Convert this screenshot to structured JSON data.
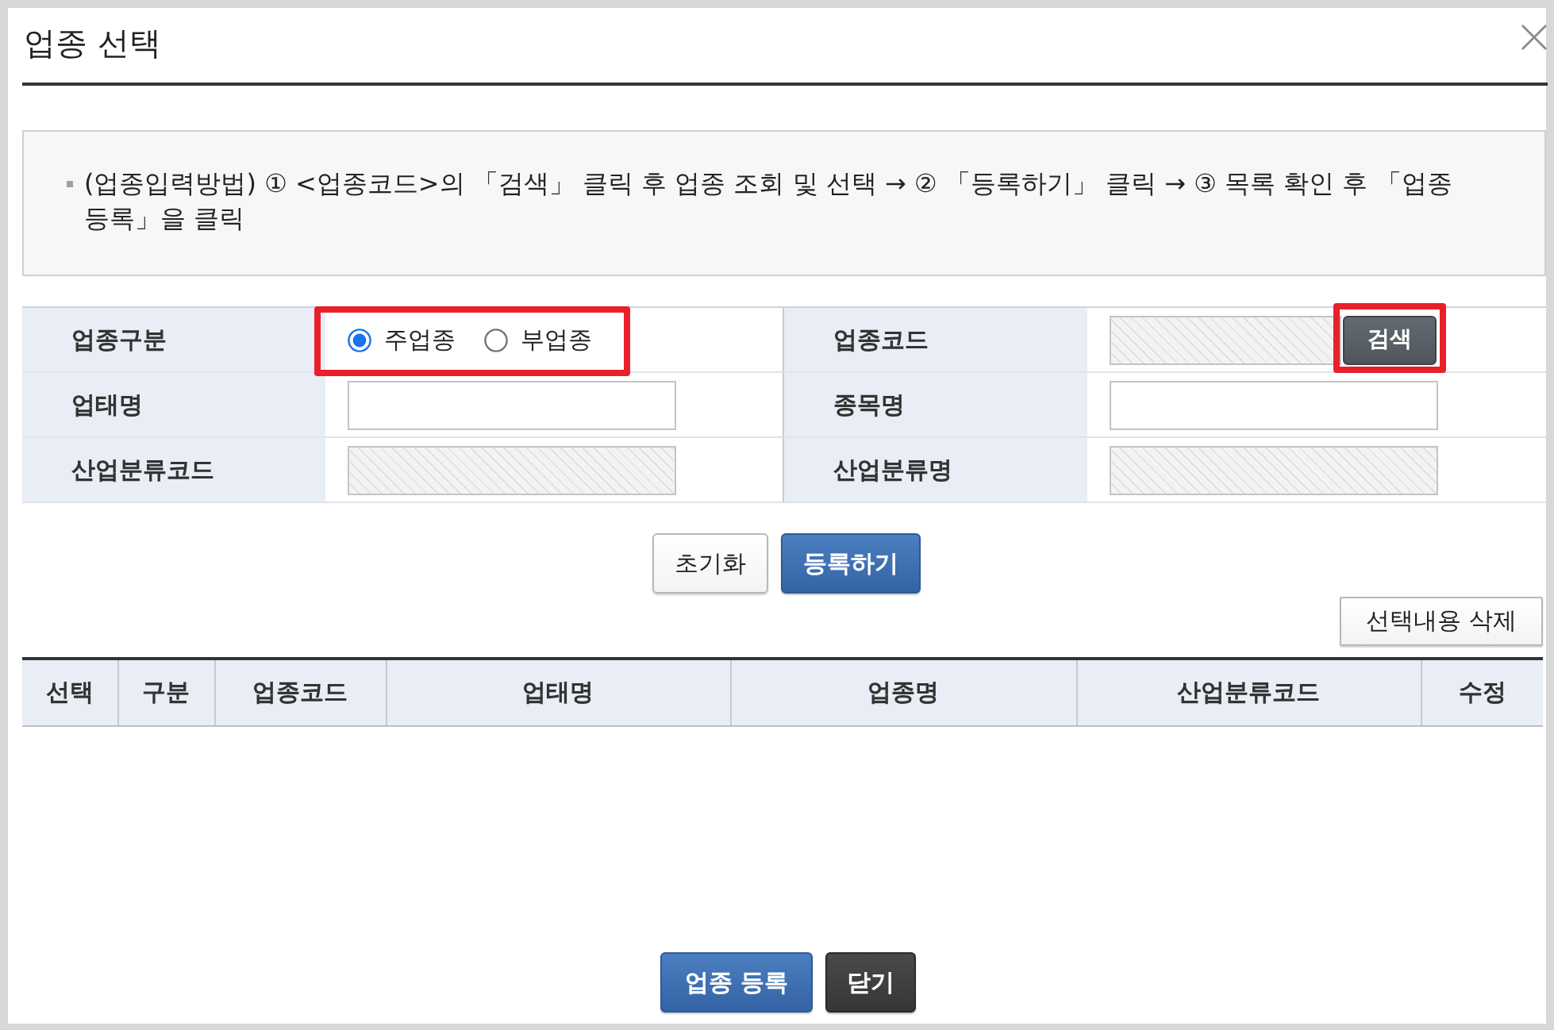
{
  "dialog": {
    "title": "업종 선택"
  },
  "guide": {
    "text": "(업종입력방법) ① <업종코드>의 「검색」 클릭 후 업종 조회 및 선택 → ② 「등록하기」 클릭 → ③ 목록 확인 후 「업종 등록」을 클릭"
  },
  "form": {
    "rows": [
      [
        {
          "label": "업종구분",
          "kind": "radio",
          "highlighted": true,
          "options": [
            {
              "label": "주업종",
              "selected": true
            },
            {
              "label": "부업종",
              "selected": false
            }
          ]
        },
        {
          "label": "업종코드",
          "kind": "search",
          "button": "검색",
          "highlighted": true
        }
      ],
      [
        {
          "label": "업태명",
          "kind": "input",
          "highlighted": false
        },
        {
          "label": "종목명",
          "kind": "input",
          "highlighted": false
        }
      ],
      [
        {
          "label": "산업분류코드",
          "kind": "readonly",
          "highlighted": false
        },
        {
          "label": "산업분류명",
          "kind": "readonly",
          "highlighted": false
        }
      ]
    ]
  },
  "actions": [
    {
      "label": "초기화",
      "kind": "plain"
    },
    {
      "label": "등록하기",
      "kind": "primary"
    }
  ],
  "delete_button": {
    "label": "선택내용 삭제"
  },
  "list_table": {
    "columns": [
      "선택",
      "구분",
      "업종코드",
      "업태명",
      "업종명",
      "산업분류코드",
      "수정"
    ]
  },
  "footer_buttons": [
    {
      "label": "업종 등록",
      "kind": "primary"
    },
    {
      "label": "닫기",
      "kind": "dark"
    }
  ]
}
